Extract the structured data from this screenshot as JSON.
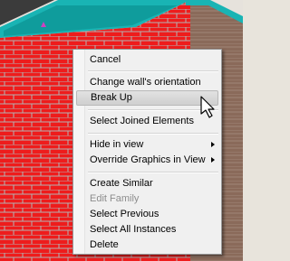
{
  "context_menu": {
    "items": [
      {
        "label": "Cancel"
      },
      {
        "label": "Change wall's orientation"
      },
      {
        "label": "Break Up"
      },
      {
        "label": "Select Joined Elements"
      },
      {
        "label": "Hide in view"
      },
      {
        "label": "Override Graphics in View"
      },
      {
        "label": "Create Similar"
      },
      {
        "label": "Edit Family"
      },
      {
        "label": "Select Previous"
      },
      {
        "label": "Select All Instances"
      },
      {
        "label": "Delete"
      }
    ]
  },
  "colors": {
    "brick": "#ee1c1c",
    "mortar": "#b3b3b3",
    "wall_top": "#19b4b4",
    "side_wall": "#8a6a5a",
    "menu_bg": "#f0f0f0",
    "highlight": "#d6d6d6"
  },
  "icons": [
    "mouse-pointer-icon",
    "submenu-arrow-icon"
  ]
}
